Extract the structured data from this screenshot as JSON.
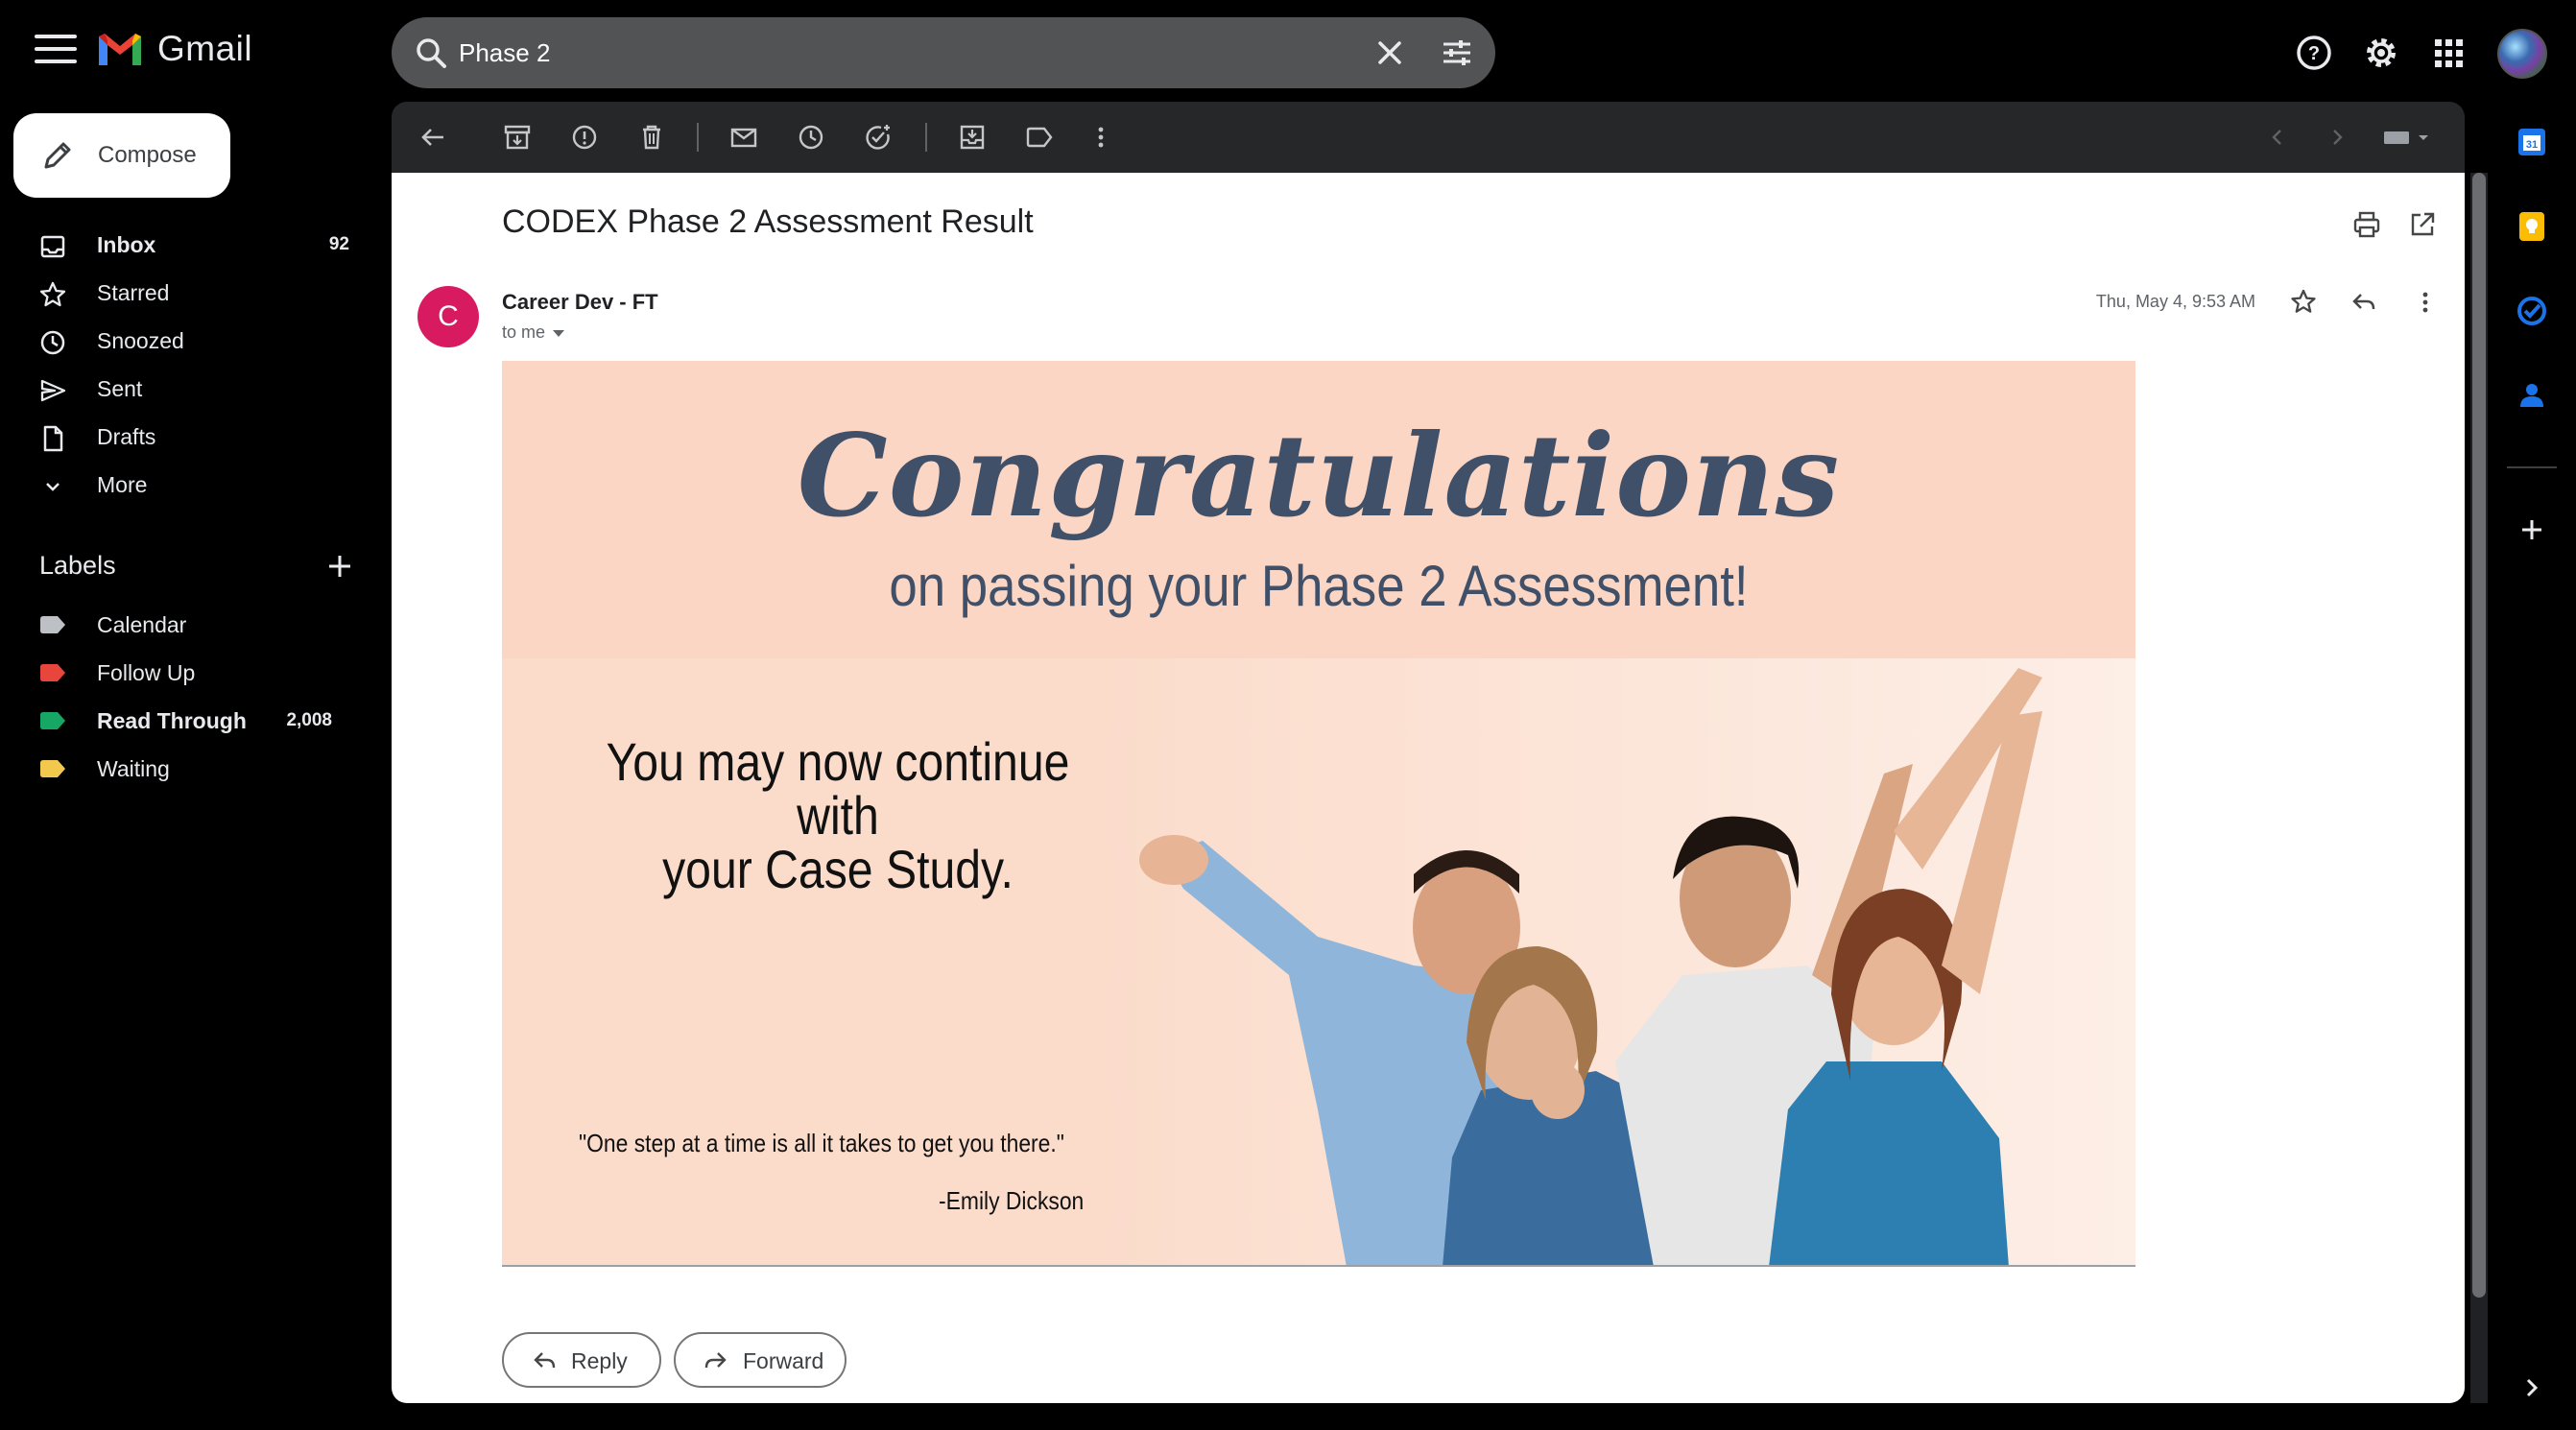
{
  "app": {
    "name": "Gmail"
  },
  "search": {
    "value": "Phase 2"
  },
  "compose": {
    "label": "Compose"
  },
  "nav": [
    {
      "label": "Inbox",
      "count": "92",
      "bold": true,
      "icon": "inbox-icon"
    },
    {
      "label": "Starred",
      "count": "",
      "icon": "star-icon"
    },
    {
      "label": "Snoozed",
      "count": "",
      "icon": "clock-icon"
    },
    {
      "label": "Sent",
      "count": "",
      "icon": "send-icon"
    },
    {
      "label": "Drafts",
      "count": "",
      "icon": "draft-icon"
    },
    {
      "label": "More",
      "count": "",
      "icon": "chevron-down-icon"
    }
  ],
  "labels": {
    "heading": "Labels",
    "items": [
      {
        "label": "Calendar",
        "count": "",
        "color": "#bdc1c6"
      },
      {
        "label": "Follow Up",
        "count": "",
        "color": "#e8453c"
      },
      {
        "label": "Read Through",
        "count": "2,008",
        "color": "#16a765"
      },
      {
        "label": "Waiting",
        "count": "",
        "color": "#f2c94c"
      }
    ]
  },
  "message": {
    "subject": "CODEX Phase 2 Assessment Result",
    "sender_initial": "C",
    "sender_name": "Career Dev - FT",
    "recipient": "to me",
    "date": "Thu, May 4, 9:53 AM",
    "avatar_color": "#d81b60"
  },
  "banner": {
    "headline": "Congratulations",
    "subheadline": "on passing your Phase 2 Assessment!",
    "body_line1": "You may now continue with",
    "body_line2": "your Case Study.",
    "quote": "\"One step at a time is all it takes to get you there.\"",
    "quote_author": "-Emily Dickson"
  },
  "actions": {
    "reply": "Reply",
    "forward": "Forward"
  }
}
